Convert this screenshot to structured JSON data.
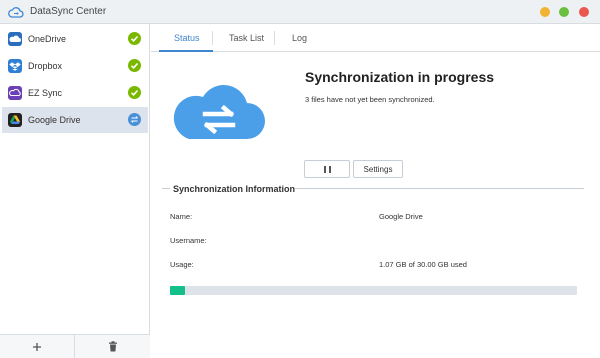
{
  "window": {
    "title": "DataSync Center"
  },
  "sidebar": {
    "items": [
      {
        "label": "OneDrive",
        "status": "synced",
        "icon": "onedrive-icon",
        "icon_color": "#2a6ebd"
      },
      {
        "label": "Dropbox",
        "status": "synced",
        "icon": "dropbox-icon",
        "icon_color": "#2f7fd6"
      },
      {
        "label": "EZ Sync",
        "status": "synced",
        "icon": "ez-sync-icon",
        "icon_color": "#6b3fb5"
      },
      {
        "label": "Google Drive",
        "status": "syncing",
        "icon": "google-drive-icon",
        "icon_color": "#222222"
      }
    ],
    "footer": {
      "add_icon": "plus-icon",
      "delete_icon": "trash-icon"
    }
  },
  "tabs": [
    {
      "label": "Status",
      "active": true
    },
    {
      "label": "Task List",
      "active": false
    },
    {
      "label": "Log",
      "active": false
    }
  ],
  "status": {
    "title": "Synchronization in progress",
    "subtitle": "3 files have not yet been synchronized.",
    "settings_label": "Settings"
  },
  "info": {
    "section_title": "Synchronization Information",
    "name_label": "Name:",
    "name_value": "Google Drive",
    "username_label": "Username:",
    "username_value": "",
    "usage_label": "Usage:",
    "usage_value": "1.07 GB of 30.00 GB used",
    "usage_fraction": 0.0357
  },
  "colors": {
    "accent": "#3e86d0",
    "cloud": "#4a9fe8",
    "progress": "#14c08a",
    "synced": "#7ab800"
  }
}
